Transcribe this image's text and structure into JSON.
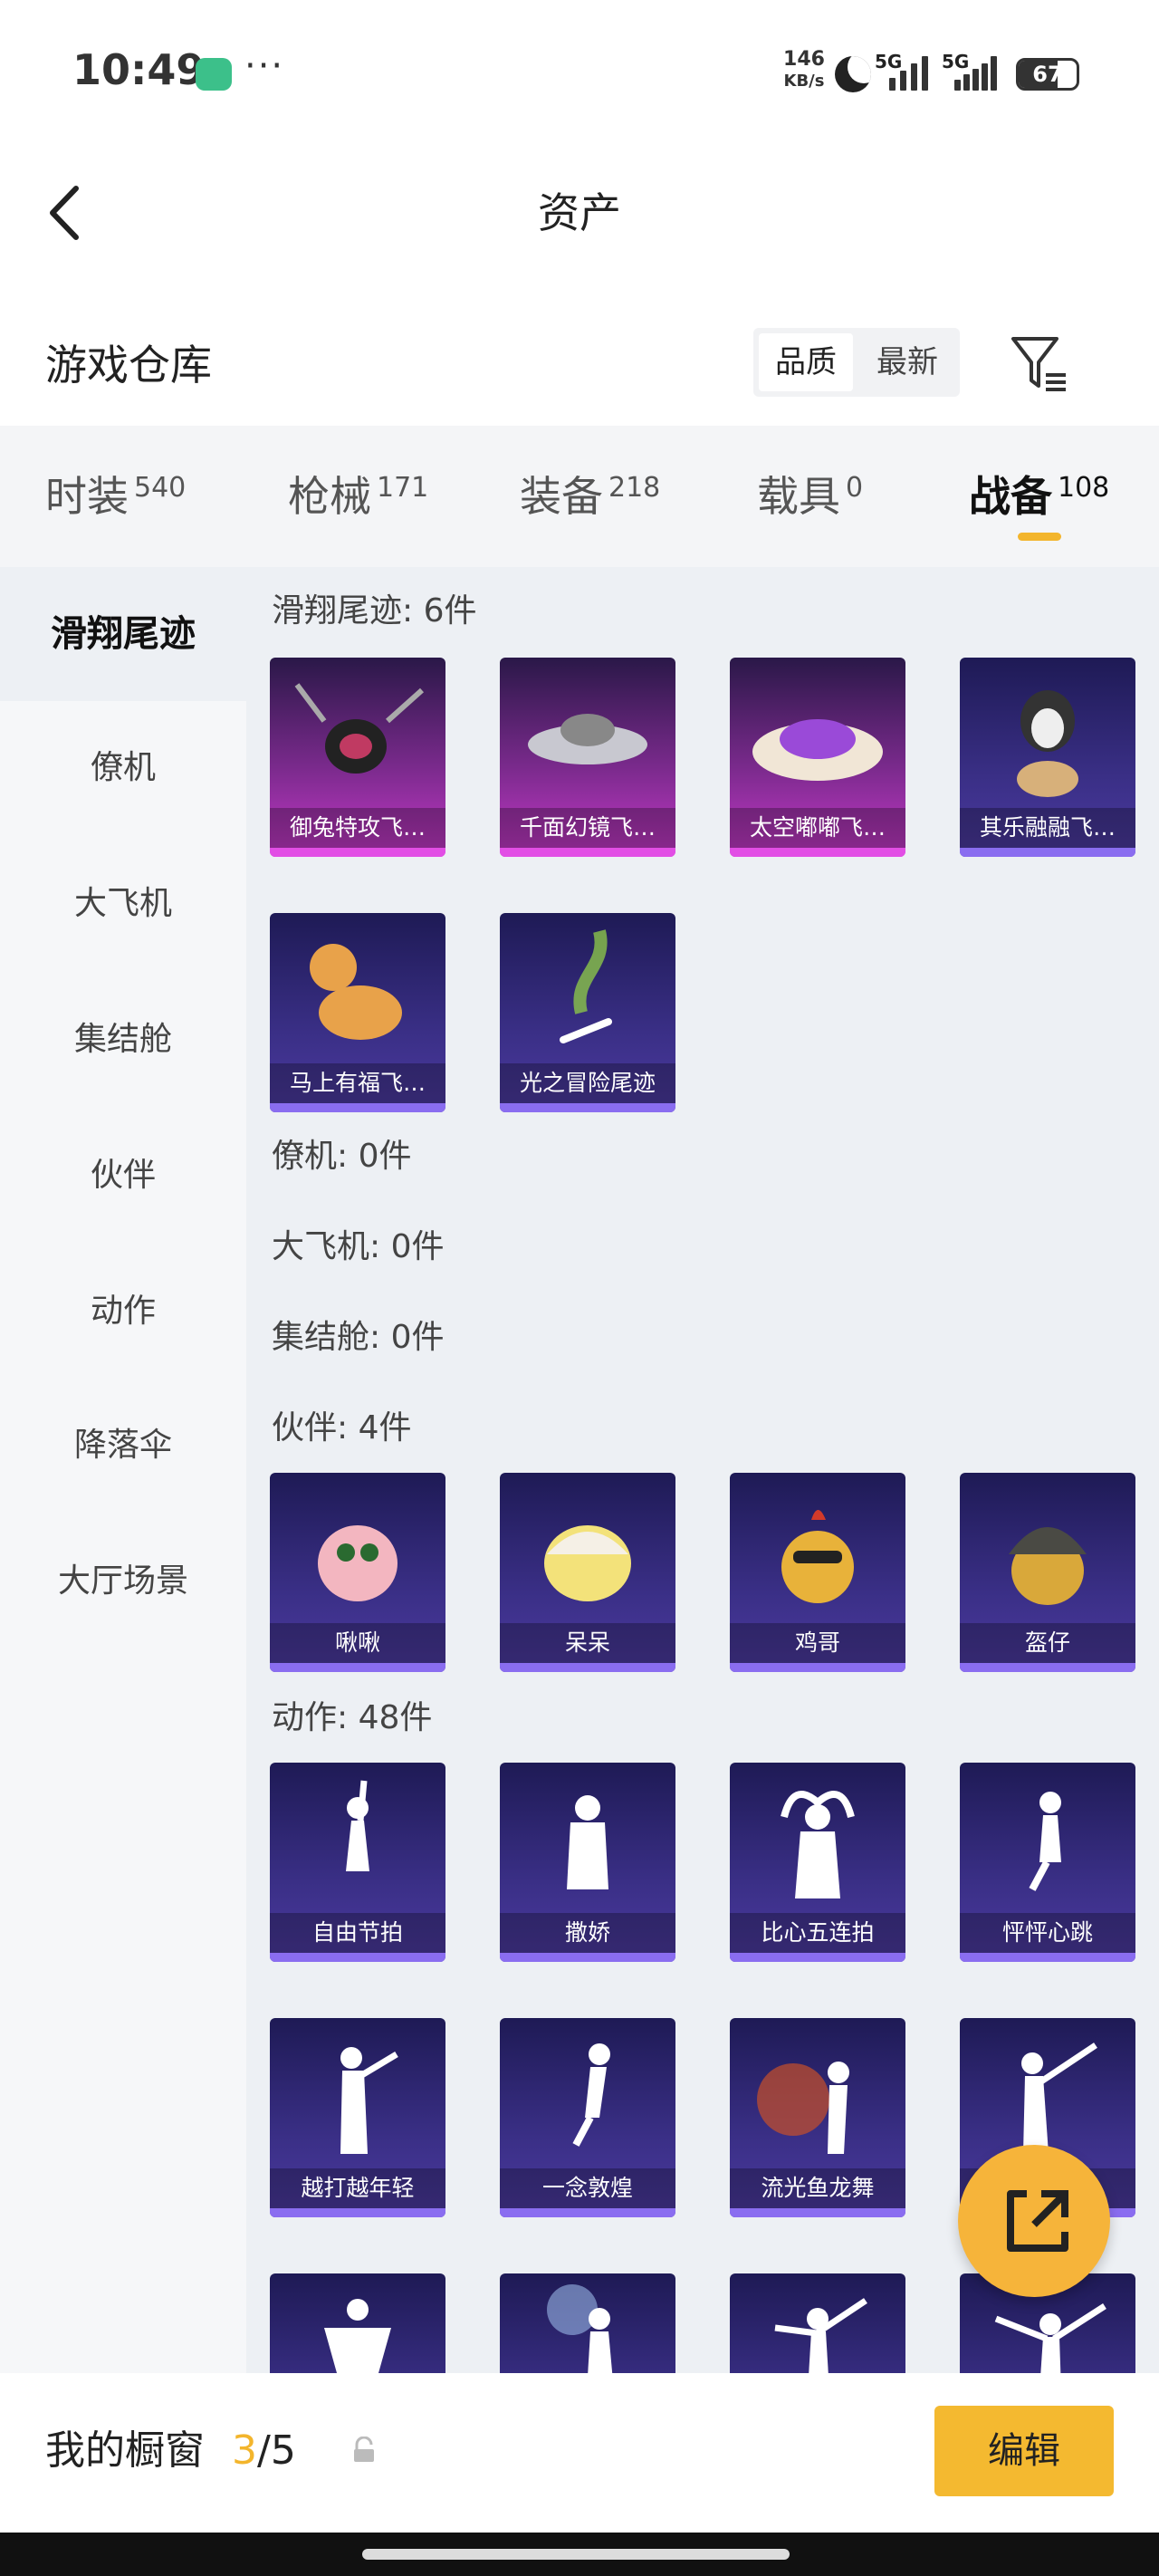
{
  "status": {
    "time": "10:49",
    "net_speed": "146\nKB/s",
    "sim1": "5G",
    "sim2": "5G",
    "battery": "67",
    "battery_level": 0.67
  },
  "header": {
    "title": "资产",
    "section_title": "游戏仓库",
    "sort_options": [
      "品质",
      "最新"
    ],
    "active_sort": "品质"
  },
  "tabs": [
    {
      "label": "时装",
      "count": "540"
    },
    {
      "label": "枪械",
      "count": "171"
    },
    {
      "label": "装备",
      "count": "218"
    },
    {
      "label": "载具",
      "count": "0"
    },
    {
      "label": "战备",
      "count": "108"
    }
  ],
  "active_tab": "战备",
  "sidebar": [
    "滑翔尾迹",
    "僚机",
    "大飞机",
    "集结舱",
    "伙伴",
    "动作",
    "降落伞",
    "大厅场景"
  ],
  "sections": [
    {
      "heading": "滑翔尾迹: 6件",
      "items": [
        "御兔特攻飞…",
        "千面幻镜飞…",
        "太空嘟嘟飞…",
        "其乐融融飞…",
        "马上有福飞…",
        "光之冒险尾迹"
      ]
    },
    {
      "heading": "僚机: 0件",
      "items": []
    },
    {
      "heading": "大飞机: 0件",
      "items": []
    },
    {
      "heading": "集结舱: 0件",
      "items": []
    },
    {
      "heading": "伙伴: 4件",
      "items": [
        "啾啾",
        "呆呆",
        "鸡哥",
        "盔仔"
      ]
    },
    {
      "heading": "动作: 48件",
      "items": [
        "自由节拍",
        "撒娇",
        "比心五连拍",
        "怦怦心跳",
        "越打越年轻",
        "一念敦煌",
        "流光鱼龙舞",
        "",
        "",
        "",
        "",
        ""
      ]
    }
  ],
  "bottom": {
    "showcase_label": "我的橱窗",
    "showcase_current": "3",
    "showcase_total": "/5",
    "edit_label": "编辑"
  },
  "colors": {
    "accent": "#f3b52c",
    "card_blue": "#3a2f86",
    "card_purple": "#c439c8"
  }
}
